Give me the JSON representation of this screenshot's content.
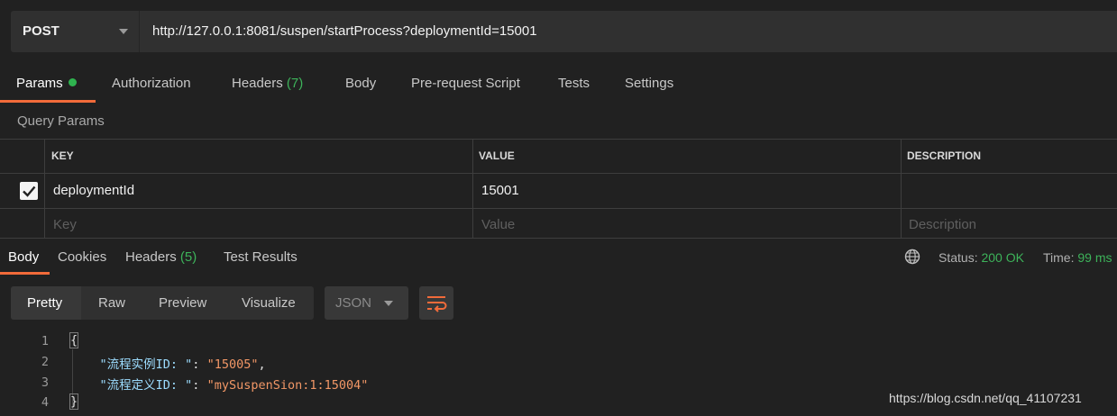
{
  "request": {
    "method": "POST",
    "url": "http://127.0.0.1:8081/suspen/startProcess?deploymentId=15001"
  },
  "request_tabs": [
    {
      "label": "Params",
      "active": true,
      "has_dot": true
    },
    {
      "label": "Authorization"
    },
    {
      "label": "Headers",
      "count": "(7)"
    },
    {
      "label": "Body"
    },
    {
      "label": "Pre-request Script"
    },
    {
      "label": "Tests"
    },
    {
      "label": "Settings"
    }
  ],
  "query_params": {
    "title": "Query Params",
    "columns": [
      "KEY",
      "VALUE",
      "DESCRIPTION"
    ],
    "rows": [
      {
        "checked": true,
        "key": "deploymentId",
        "value": "15001",
        "description": ""
      }
    ],
    "placeholders": {
      "key": "Key",
      "value": "Value",
      "description": "Description"
    }
  },
  "response_tabs": [
    {
      "label": "Body",
      "active": true
    },
    {
      "label": "Cookies"
    },
    {
      "label": "Headers",
      "count": "(5)"
    },
    {
      "label": "Test Results"
    }
  ],
  "response_status": {
    "status_label": "Status:",
    "status_value": "200 OK",
    "time_label": "Time:",
    "time_value": "99 ms"
  },
  "view_modes": [
    "Pretty",
    "Raw",
    "Preview",
    "Visualize"
  ],
  "format": "JSON",
  "body_lines": [
    {
      "n": "1",
      "text": "{"
    },
    {
      "n": "2",
      "key": "\"流程实例ID: \"",
      "sep": ": ",
      "value": "\"15005\"",
      "end": ","
    },
    {
      "n": "3",
      "key": "\"流程定义ID: \"",
      "sep": ": ",
      "value": "\"mySuspenSion:1:15004\"",
      "end": ""
    },
    {
      "n": "4",
      "text": "}"
    }
  ],
  "watermark": "https://blog.csdn.net/qq_41107231",
  "colors": {
    "accent": "#f26b3a",
    "success": "#3db35a",
    "background": "#212121"
  }
}
